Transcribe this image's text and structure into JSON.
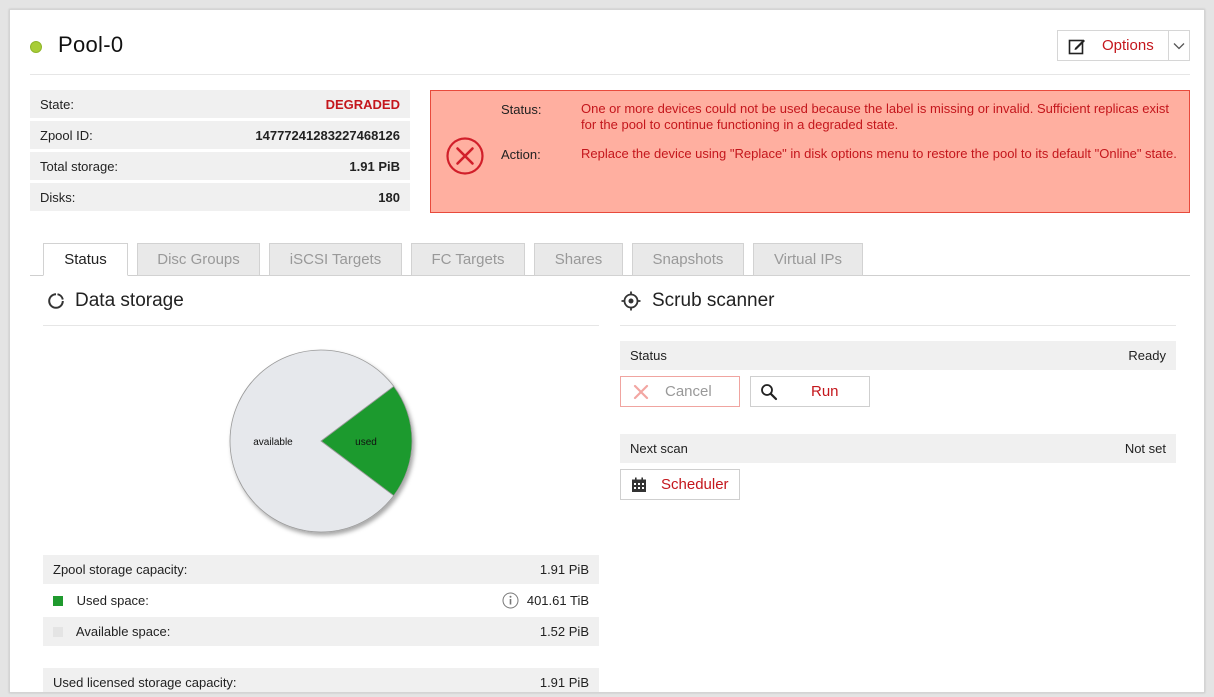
{
  "pool": {
    "name": "Pool-0",
    "status_color": "#a8cd37",
    "options_label": "Options"
  },
  "info": {
    "state_label": "State:",
    "state_value": "DEGRADED",
    "zpool_id_label": "Zpool ID:",
    "zpool_id_value": "14777241283227468126",
    "total_storage_label": "Total storage:",
    "total_storage_value": "1.91 PiB",
    "disks_label": "Disks:",
    "disks_value": "180"
  },
  "alert": {
    "status_label": "Status:",
    "status_text": "One or more devices could not be used because the label is missing or invalid. Sufficient replicas exist for the pool to continue functioning in a degraded state.",
    "action_label": "Action:",
    "action_text": "Replace the device using \"Replace\" in disk options menu to restore the pool to its default \"Online\" state."
  },
  "tabs": [
    {
      "label": "Status"
    },
    {
      "label": "Disc Groups"
    },
    {
      "label": "iSCSI Targets"
    },
    {
      "label": "FC Targets"
    },
    {
      "label": "Shares"
    },
    {
      "label": "Snapshots"
    },
    {
      "label": "Virtual IPs"
    }
  ],
  "data_storage": {
    "title": "Data storage",
    "chart_data": {
      "type": "pie",
      "slices": [
        {
          "label": "available",
          "value": 1.52,
          "color": "#e6e8ec"
        },
        {
          "label": "used",
          "value": 0.3922,
          "color": "#1f9a2e"
        }
      ]
    },
    "capacity_label": "Zpool storage capacity:",
    "capacity_value": "1.91 PiB",
    "used_label": "Used space:",
    "used_value": "401.61 TiB",
    "available_label": "Available space:",
    "available_value": "1.52 PiB",
    "licensed_label": "Used licensed storage capacity:",
    "licensed_value": "1.91 PiB"
  },
  "scrub": {
    "title": "Scrub scanner",
    "status_label": "Status",
    "status_value": "Ready",
    "cancel_label": "Cancel",
    "run_label": "Run",
    "next_scan_label": "Next scan",
    "next_scan_value": "Not set",
    "scheduler_label": "Scheduler"
  },
  "colors": {
    "accent_red": "#c4161c",
    "alert_bg": "#ffafa0",
    "used_green": "#1f9a2e"
  }
}
